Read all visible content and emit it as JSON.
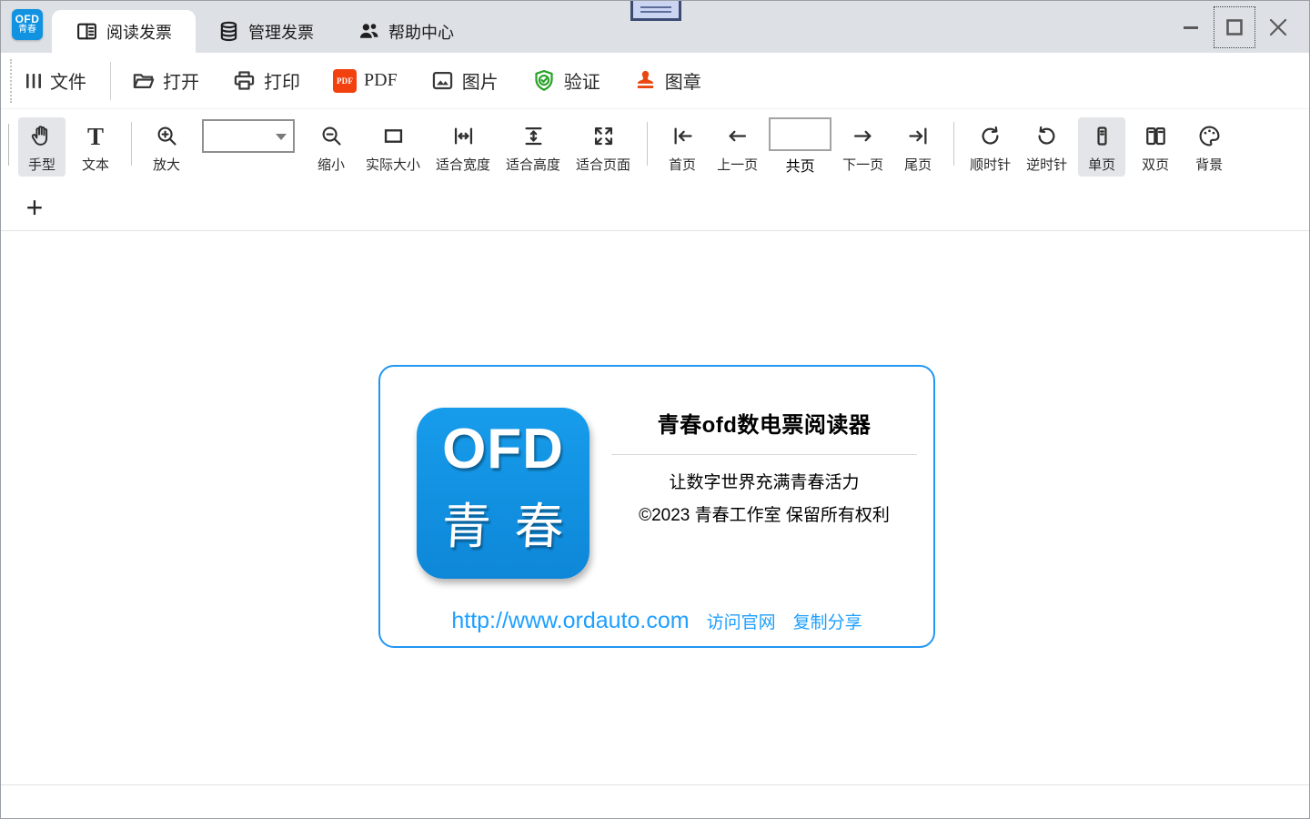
{
  "titlebar": {
    "tabs": [
      {
        "label": "阅读发票",
        "active": true
      },
      {
        "label": "管理发票",
        "active": false
      },
      {
        "label": "帮助中心",
        "active": false
      }
    ]
  },
  "file_toolbar": {
    "pdf_badge": "PDF",
    "items": [
      {
        "label": "文件"
      },
      {
        "label": "打开"
      },
      {
        "label": "打印"
      },
      {
        "label": "PDF"
      },
      {
        "label": "图片"
      },
      {
        "label": "验证"
      },
      {
        "label": "图章"
      }
    ]
  },
  "view_toolbar": {
    "t_glyph": "T",
    "zoom_combo_value": "",
    "page_input_value": "",
    "items": [
      {
        "label": "手型"
      },
      {
        "label": "文本"
      },
      {
        "label": "放大"
      },
      {
        "label": "缩小"
      },
      {
        "label": "实际大小"
      },
      {
        "label": "适合宽度"
      },
      {
        "label": "适合高度"
      },
      {
        "label": "适合页面"
      },
      {
        "label": "首页"
      },
      {
        "label": "上一页"
      },
      {
        "label": "共页"
      },
      {
        "label": "下一页"
      },
      {
        "label": "尾页"
      },
      {
        "label": "顺时针"
      },
      {
        "label": "逆时针"
      },
      {
        "label": "单页"
      },
      {
        "label": "双页"
      },
      {
        "label": "背景"
      }
    ]
  },
  "page_tabs": {
    "add_label": "+"
  },
  "about_card": {
    "logo": {
      "line1": "OFD",
      "char1": "青",
      "char2": "春"
    },
    "app_logo": {
      "line1": "OFD",
      "line2": "青春"
    },
    "title": "青春ofd数电票阅读器",
    "tagline": "让数字世界充满青春活力",
    "copyright": "©2023 青春工作室 保留所有权利",
    "url": "http://www.ordauto.com",
    "links": [
      {
        "label": "访问官网"
      },
      {
        "label": "复制分享"
      }
    ]
  },
  "colors": {
    "titlebar_bg": "#dde1e6",
    "logo_blue": "#1193e2",
    "link_blue": "#1e9fff",
    "card_border_blue": "#2196f3",
    "pdf_orange": "#f2400f",
    "stamp_orange": "#e8470f",
    "shield_green": "#28a228"
  }
}
